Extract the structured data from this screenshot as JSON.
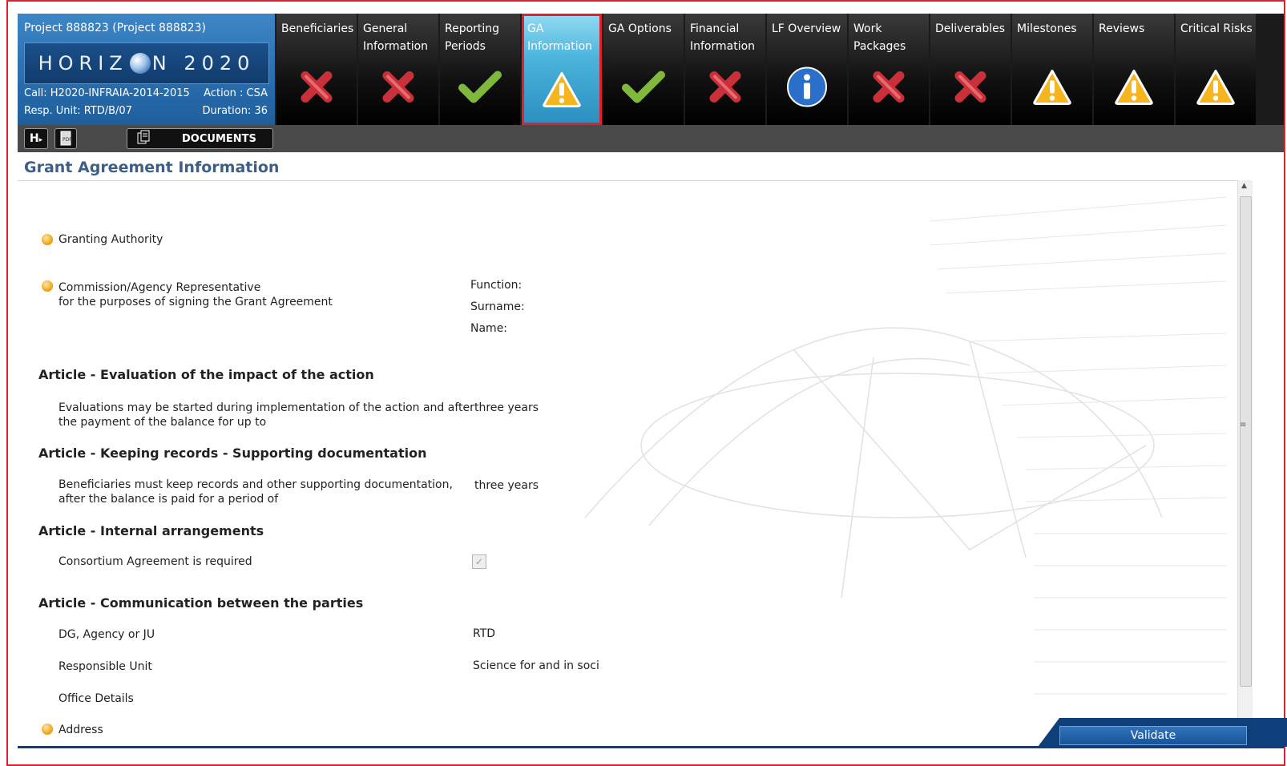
{
  "project": {
    "title": "Project 888823 (Project 888823)",
    "logo": "HORIZON 2020",
    "call": "Call: H2020-INFRAIA-2014-2015",
    "action": "Action : CSA",
    "resp_unit": "Resp. Unit: RTD/B/07",
    "duration": "Duration: 36"
  },
  "tabs": [
    {
      "label": "Beneficiaries",
      "status": "error-x-icon"
    },
    {
      "label": "General\nInformation",
      "status": "error-x-icon"
    },
    {
      "label": "Reporting\nPeriods",
      "status": "check-icon"
    },
    {
      "label": "GA\nInformation",
      "status": "warning-icon",
      "selected": true
    },
    {
      "label": "GA Options",
      "status": "check-icon"
    },
    {
      "label": "Financial\nInformation",
      "status": "error-x-icon"
    },
    {
      "label": "LF Overview",
      "status": "info-icon"
    },
    {
      "label": "Work\nPackages",
      "status": "error-x-icon"
    },
    {
      "label": "Deliverables",
      "status": "error-x-icon"
    },
    {
      "label": "Milestones",
      "status": "warning-icon"
    },
    {
      "label": "Reviews",
      "status": "warning-icon"
    },
    {
      "label": "Critical Risks",
      "status": "warning-icon"
    }
  ],
  "toolbar": {
    "h_label": "H",
    "documents_label": "DOCUMENTS"
  },
  "page_title": "Grant Agreement Information",
  "sections": {
    "granting_authority": "Granting Authority",
    "representative_line1": "Commission/Agency Representative",
    "representative_line2": "for the purposes of signing the Grant Agreement",
    "function_label": "Function:",
    "surname_label": "Surname:",
    "name_label": "Name:",
    "impact_header": "Article - Evaluation of the impact of the action",
    "impact_text1": "Evaluations may be started during implementation of the action and after",
    "impact_text2": "the payment of the balance for up to",
    "impact_value": "three years",
    "records_header": "Article - Keeping records - Supporting documentation",
    "records_text1": "Beneficiaries must keep records and other supporting documentation,",
    "records_text2": "after the balance is paid for a period of",
    "records_value": "three years",
    "internal_header": "Article - Internal arrangements",
    "consortium_label": "Consortium Agreement is required",
    "consortium_checked": true,
    "communication_header": "Article - Communication between the parties",
    "dg_label": "DG, Agency or JU",
    "dg_value": "RTD",
    "unit_label": "Responsible Unit",
    "unit_value": "Science for and in soci",
    "office_label": "Office Details",
    "address_label": "Address"
  },
  "validate_label": "Validate",
  "colors": {
    "accent_red": "#d9232d",
    "title_blue": "#3e5e86",
    "validate_blue": "#0f3f7b"
  }
}
